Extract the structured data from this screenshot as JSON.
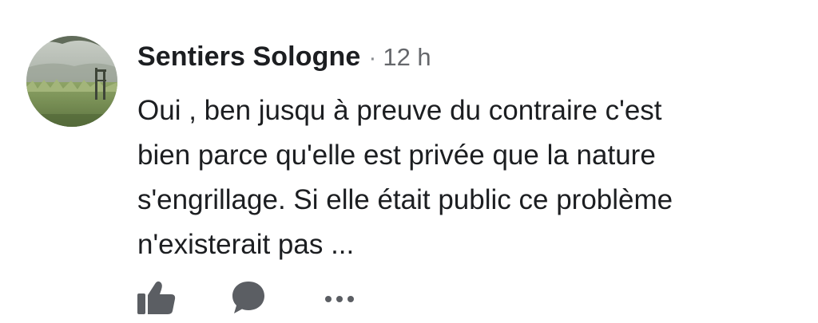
{
  "comment": {
    "author": "Sentiers Sologne",
    "separator": "·",
    "time": "12 h",
    "text_lines": [
      "Oui , ben jusqu à preuve du contraire c'est",
      "bien parce qu'elle est privée que la nature",
      "s'engrillage. Si elle était public ce problème",
      "n'existerait pas ..."
    ]
  },
  "actions": {
    "icons": [
      "thumbs-up-icon",
      "speech-bubble-icon",
      "more-dots-icon"
    ]
  },
  "colors": {
    "text": "#1c1e21",
    "meta": "#65676b",
    "icon": "#5b5e63"
  }
}
